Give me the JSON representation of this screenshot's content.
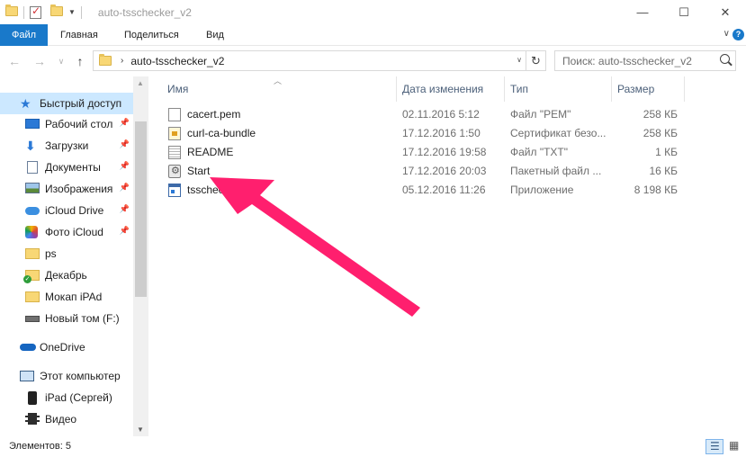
{
  "window": {
    "title": "auto-tsschecker_v2",
    "minimize_glyph": "—",
    "maximize_glyph": "☐",
    "close_glyph": "✕"
  },
  "ribbon": {
    "tabs": [
      "Файл",
      "Главная",
      "Поделиться",
      "Вид"
    ],
    "help_glyph": "?",
    "expand_glyph": "∨"
  },
  "nav": {
    "back_glyph": "←",
    "forward_glyph": "→",
    "recent_glyph": "∨",
    "up_glyph": "↑",
    "breadcrumb": "auto-tsschecker_v2",
    "refresh_glyph": "↻",
    "search_placeholder": "Поиск: auto-tsschecker_v2"
  },
  "sidebar": {
    "items": [
      {
        "label": "Быстрый доступ",
        "icon": "star-icon",
        "pinned": false
      },
      {
        "label": "Рабочий стол",
        "icon": "desktop-icon",
        "pinned": true
      },
      {
        "label": "Загрузки",
        "icon": "downloads-icon",
        "pinned": true
      },
      {
        "label": "Документы",
        "icon": "documents-icon",
        "pinned": true
      },
      {
        "label": "Изображения",
        "icon": "pictures-icon",
        "pinned": true
      },
      {
        "label": "iCloud Drive",
        "icon": "icloud-drive-icon",
        "pinned": true
      },
      {
        "label": "Фото iCloud",
        "icon": "icloud-photos-icon",
        "pinned": true
      },
      {
        "label": "ps",
        "icon": "folder-icon",
        "pinned": false
      },
      {
        "label": "Декабрь",
        "icon": "folder-sync-icon",
        "pinned": false
      },
      {
        "label": "Мокап iPAd",
        "icon": "folder-icon",
        "pinned": false
      },
      {
        "label": "Новый том (F:)",
        "icon": "drive-icon",
        "pinned": false
      },
      {
        "label": "OneDrive",
        "icon": "onedrive-icon",
        "pinned": false
      },
      {
        "label": "Этот компьютер",
        "icon": "computer-icon",
        "pinned": false
      },
      {
        "label": "iPad (Сергей)",
        "icon": "ipad-icon",
        "pinned": false
      },
      {
        "label": "Видео",
        "icon": "video-icon",
        "pinned": false
      }
    ]
  },
  "columns": {
    "name": "Имя",
    "date": "Дата изменения",
    "type": "Тип",
    "size": "Размер"
  },
  "files": [
    {
      "name": "cacert.pem",
      "date": "02.11.2016 5:12",
      "type": "Файл \"PEM\"",
      "size": "258 КБ",
      "icon": "pem-file-icon"
    },
    {
      "name": "curl-ca-bundle",
      "date": "17.12.2016 1:50",
      "type": "Сертификат безо...",
      "size": "258 КБ",
      "icon": "certificate-icon"
    },
    {
      "name": "README",
      "date": "17.12.2016 19:58",
      "type": "Файл \"TXT\"",
      "size": "1 КБ",
      "icon": "text-file-icon"
    },
    {
      "name": "Start",
      "date": "17.12.2016 20:03",
      "type": "Пакетный файл ...",
      "size": "16 КБ",
      "icon": "batch-file-icon"
    },
    {
      "name": "tsscheck",
      "date": "05.12.2016 11:26",
      "type": "Приложение",
      "size": "8 198 КБ",
      "icon": "application-icon"
    }
  ],
  "status": {
    "items_count": "Элементов: 5"
  },
  "colors": {
    "accent": "#1979ca",
    "selection": "#cce8ff",
    "annotation_arrow": "#ff1f6e"
  }
}
